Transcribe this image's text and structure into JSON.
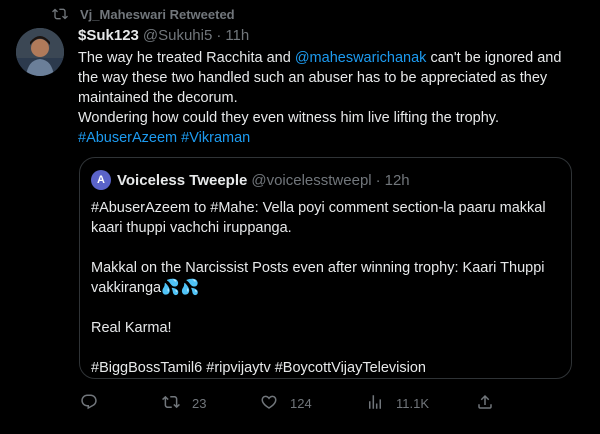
{
  "retweet": {
    "label": "Vj_Maheswari Retweeted",
    "icon": "retweet-icon"
  },
  "tweet": {
    "display_name": "$Suk123",
    "handle": "@Sukuhi5",
    "separator": "·",
    "time": "11h",
    "text_part1": "The way he treated Racchita and ",
    "mention": "@maheswarichanak",
    "text_part2": " can't be ignored and the way these two handled such an abuser has to be appreciated as they maintained the decorum.",
    "text_line2": "Wondering how could they even witness him live lifting the trophy.",
    "hashtag1": "#AbuserAzeem",
    "hashtag2": "#Vikraman"
  },
  "quote": {
    "avatar_letter": "A",
    "display_name": "Voiceless Tweeple",
    "handle": "@voicelesstweepl",
    "separator": "·",
    "time": "12h",
    "para1": "#AbuserAzeem to #Mahe: Vella poyi comment section-la paaru makkal kaari thuppi vachchi iruppanga.",
    "para2": "Makkal on the Narcissist Posts even after winning trophy: Kaari Thuppi vakkiranga",
    "para2_emoji": "💦💦",
    "para3": "Real Karma!",
    "para4": "#BiggBossTamil6 #ripvijaytv #BoycottVijayTelevision"
  },
  "actions": {
    "reply_icon": "reply-icon",
    "retweet_count": "23",
    "like_count": "124",
    "views_count": "11.1K",
    "share_icon": "share-icon"
  },
  "colors": {
    "background": "#000000",
    "text": "#e7e9ea",
    "muted": "#71767b",
    "link": "#1d9bf0",
    "border": "#2f3336"
  }
}
